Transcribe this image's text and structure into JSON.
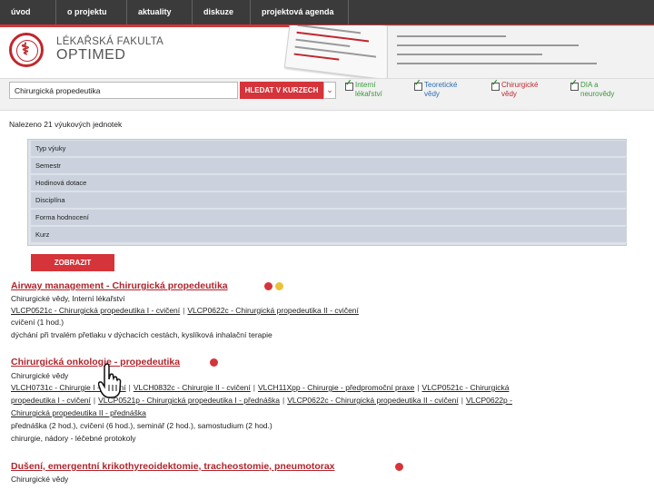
{
  "nav": {
    "items": [
      "úvod",
      "o projektu",
      "aktuality",
      "diskuze",
      "projektová agenda"
    ]
  },
  "header": {
    "faculty_name": "LÉKAŘSKÁ FAKULTA",
    "optimed": "OPTIMED"
  },
  "search": {
    "value": "Chirurgická propedeutika",
    "button_label": "HLEDAT V KURZECH",
    "filters": [
      {
        "line1": "Interní",
        "line2": "lékařství",
        "checked": true
      },
      {
        "line1": "Teoretické",
        "line2": "vědy",
        "checked": true
      },
      {
        "line1": "Chirurgické",
        "line2": "vědy",
        "checked": true
      },
      {
        "line1": "DIA a",
        "line2": "neurovědy",
        "checked": true
      }
    ]
  },
  "results": {
    "found_text": "Nalezeno 21 výukových jednotek",
    "filter_rows": [
      "Typ výuky",
      "Semestr",
      "Hodinová dotace",
      "Disciplína",
      "Forma hodnocení",
      "Kurz"
    ],
    "show_button": "ZOBRAZIT",
    "items": [
      {
        "title": "Airway management - Chirurgická propedeutika",
        "categories": "Chirurgické vědy, Interní lékařství",
        "courses": [
          "VLCP0521c - Chirurgická propedeutika I - cvičení",
          "VLCP0622c - Chirurgická propedeutika II - cvičení"
        ],
        "hours": "cvičení (1 hod.)",
        "keywords": "dýchání při trvalém přetlaku v dýchacích cestách, kyslíková inhalační terapie",
        "dots": [
          "red",
          "yellow"
        ]
      },
      {
        "title": "Chirurgická onkologie - propedeutika",
        "categories": "Chirurgické vědy",
        "courses_line1": [
          "VLCH0731c - Chirurgie I - cvičení",
          "VLCH0832c - Chirurgie II - cvičení",
          "VLCH11Xpp - Chirurgie - předpromoční praxe",
          "VLCP0521c - Chirurgická"
        ],
        "courses_line2": [
          "propedeutika I - cvičení",
          "VLCP0521p - Chirurgická propedeutika I - přednáška",
          "VLCP0622c - Chirurgická propedeutika II - cvičení",
          "VLCP0622p -"
        ],
        "courses_line3": "Chirurgická propedeutika II - přednáška",
        "hours": "přednáška (2 hod.), cvičení (6 hod.), seminář (2 hod.), samostudium (2 hod.)",
        "keywords": "chirurgie, nádory - léčebné protokoly",
        "dots": [
          "red"
        ]
      },
      {
        "title": "Dušení, emergentní krikothyreoidektomie, tracheostomie, pneumotorax",
        "categories": "Chirurgické vědy",
        "dots": [
          "red"
        ]
      }
    ]
  },
  "colors": {
    "accent": "#d4343a",
    "nav_bg": "#3b3b3b",
    "panel": "#cbd2dd"
  }
}
